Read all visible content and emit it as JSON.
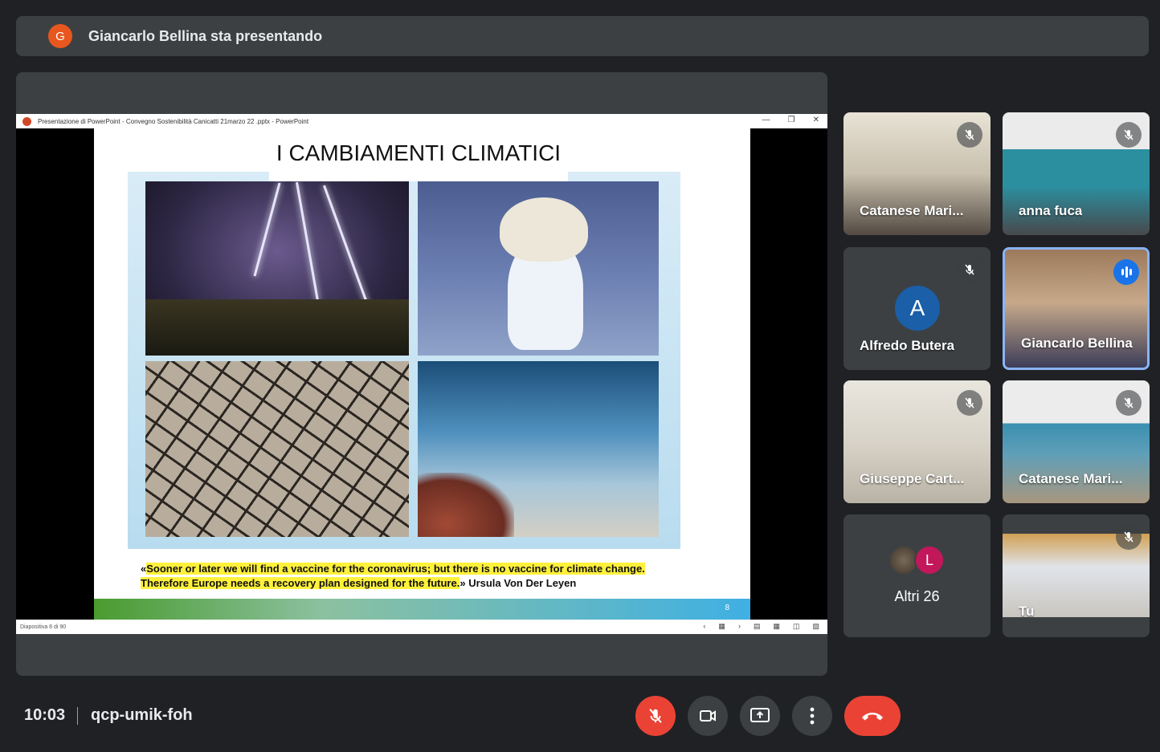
{
  "banner": {
    "avatar_letter": "G",
    "text": "Giancarlo Bellina sta presentando"
  },
  "ppt": {
    "window_title": "Presentazione di PowerPoint  -  Convegno Sostenibilità  Canicatti 21marzo 22 .pptx - PowerPoint",
    "status_text": "Diapositiva 8 di 90",
    "slide": {
      "title": "I CAMBIAMENTI CLIMATICI",
      "quote_open": "«",
      "quote_highlight_1": "Sooner or later we will find a vaccine for the coronavirus; but there is no vaccine for climate change.",
      "quote_highlight_2": "Therefore Europe needs a recovery plan designed for the future.",
      "quote_close": "»",
      "quote_author": "Ursula Von Der Leyen",
      "page_number": "8"
    }
  },
  "participants": [
    {
      "name": "Catanese Mari...",
      "mic": "off"
    },
    {
      "name": "anna fuca",
      "mic": "off"
    },
    {
      "name": "Alfredo Butera",
      "avatar_letter": "A",
      "mic": "off"
    },
    {
      "name": "Giancarlo Bellina",
      "mic": "speaking"
    },
    {
      "name": "Giuseppe Cart...",
      "mic": "off"
    },
    {
      "name": "Catanese Mari...",
      "mic": "off"
    },
    {
      "others_label": "Altri 26",
      "avatar_letter": "L"
    },
    {
      "name": "Tu",
      "mic": "off"
    }
  ],
  "footer": {
    "time": "10:03",
    "meeting_code": "qcp-umik-foh"
  },
  "colors": {
    "background": "#202124",
    "tile": "#3c4043",
    "danger": "#ea4335",
    "speaking": "#8ab4f8"
  }
}
